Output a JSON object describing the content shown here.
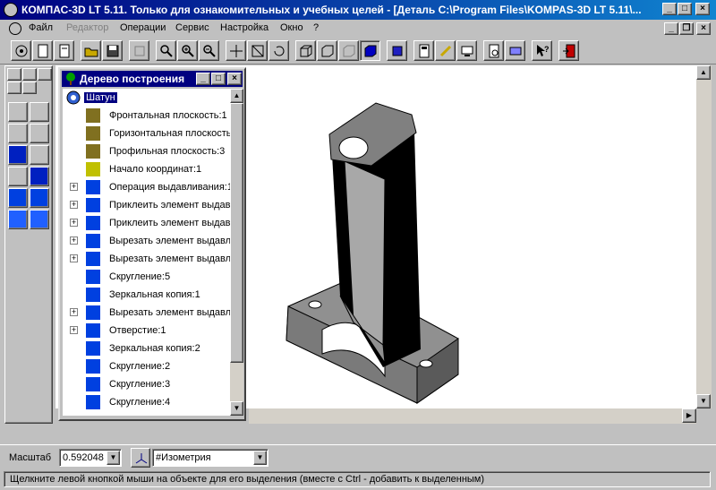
{
  "window": {
    "title": "КОМПАС-3D LT 5.11. Только для ознакомительных и учебных целей - [Деталь C:\\Program Files\\KOMPAS-3D LT 5.11\\...",
    "accent": "#000080"
  },
  "menu": {
    "items": [
      "Файл",
      "Редактор",
      "Операции",
      "Сервис",
      "Настройка",
      "Окно",
      "?"
    ],
    "disabled": [
      "Редактор"
    ]
  },
  "tree": {
    "title": "Дерево построения",
    "root": "Шатун",
    "items": [
      {
        "label": "Фронтальная плоскость:1",
        "icon": "plane-icon",
        "expandable": false
      },
      {
        "label": "Горизонтальная плоскость",
        "icon": "plane-icon",
        "expandable": false
      },
      {
        "label": "Профильная плоскость:3",
        "icon": "plane-icon",
        "expandable": false
      },
      {
        "label": "Начало координат:1",
        "icon": "origin-icon",
        "expandable": false
      },
      {
        "label": "Операция выдавливания:1",
        "icon": "extrude-icon",
        "expandable": true
      },
      {
        "label": "Приклеить элемент выдав",
        "icon": "add-extrude-icon",
        "expandable": true
      },
      {
        "label": "Приклеить элемент выдав",
        "icon": "add-extrude-icon",
        "expandable": true
      },
      {
        "label": "Вырезать элемент выдавл",
        "icon": "cut-extrude-icon",
        "expandable": true
      },
      {
        "label": "Вырезать элемент выдавл",
        "icon": "cut-extrude-icon",
        "expandable": true
      },
      {
        "label": "Скругление:5",
        "icon": "fillet-icon",
        "expandable": false
      },
      {
        "label": "Зеркальная копия:1",
        "icon": "mirror-icon",
        "expandable": false
      },
      {
        "label": "Вырезать элемент выдавл",
        "icon": "cut-extrude-icon",
        "expandable": true
      },
      {
        "label": "Отверстие:1",
        "icon": "hole-icon",
        "expandable": true
      },
      {
        "label": "Зеркальная копия:2",
        "icon": "mirror-icon",
        "expandable": false
      },
      {
        "label": "Скругление:2",
        "icon": "fillet-icon",
        "expandable": false
      },
      {
        "label": "Скругление:3",
        "icon": "fillet-icon",
        "expandable": false
      },
      {
        "label": "Скругление:4",
        "icon": "fillet-icon",
        "expandable": false
      }
    ]
  },
  "bottom": {
    "scale_label": "Масштаб",
    "scale_value": "0.592048",
    "view_value": "#Изометрия"
  },
  "status": {
    "text": "Щелкните левой кнопкой мыши на объекте для его выделения (вместе с Ctrl - добавить к выделенным)"
  }
}
